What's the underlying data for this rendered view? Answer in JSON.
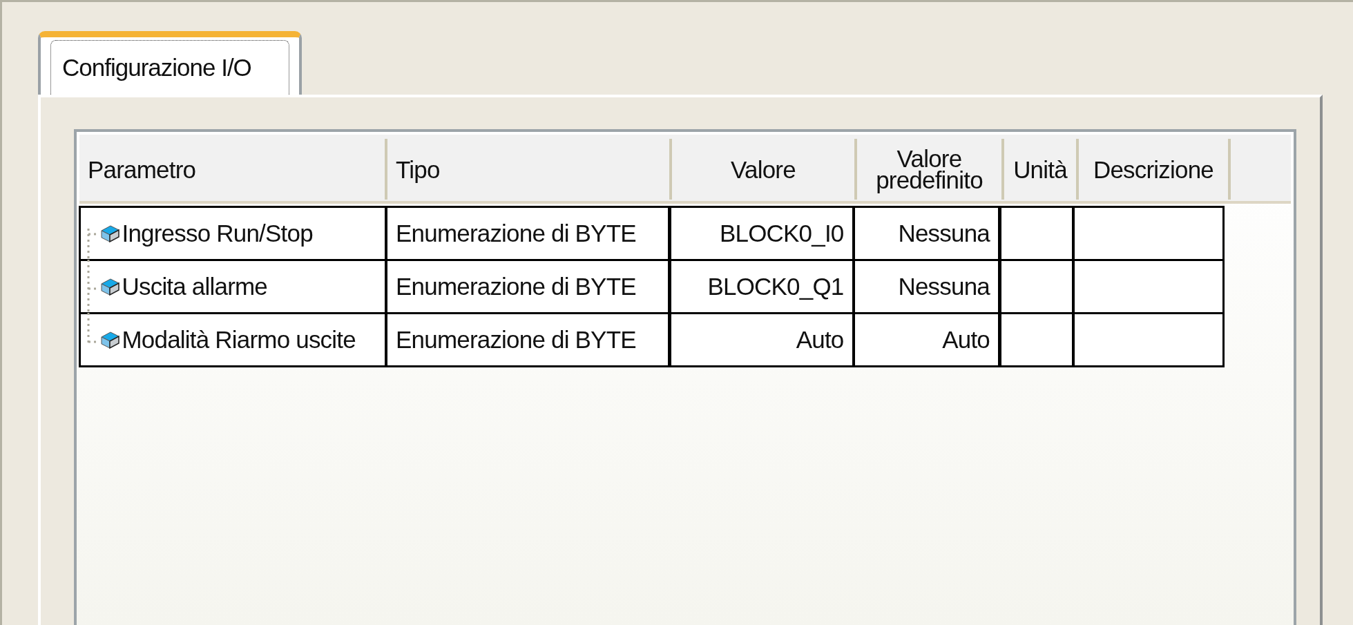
{
  "tabs": [
    {
      "label": "Configurazione I/O",
      "selected": true
    }
  ],
  "table": {
    "columns": [
      "Parametro",
      "Tipo",
      "Valore",
      "Valore predefinito",
      "Unità",
      "Descrizione"
    ],
    "rows": [
      {
        "parametro": "Ingresso Run/Stop",
        "tipo": "Enumerazione di BYTE",
        "valore": "BLOCK0_I0",
        "valore_predefinito": "Nessuna"
      },
      {
        "parametro": "Uscita allarme",
        "tipo": "Enumerazione di BYTE",
        "valore": "BLOCK0_Q1",
        "valore_predefinito": "Nessuna"
      },
      {
        "parametro": "Modalità Riarmo uscite",
        "tipo": "Enumerazione di BYTE",
        "valore": "Auto",
        "valore_predefinito": "Auto"
      }
    ]
  }
}
